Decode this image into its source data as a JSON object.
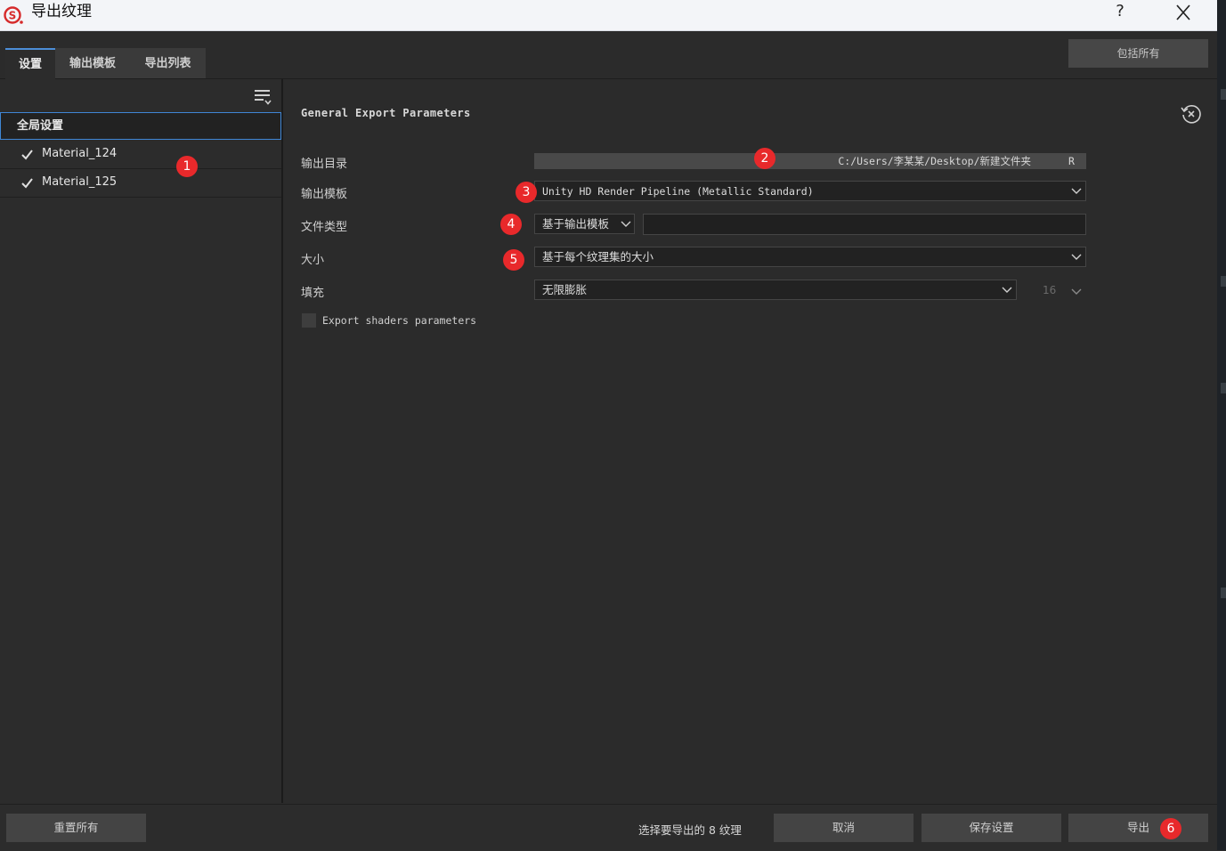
{
  "window": {
    "title": "导出纹理",
    "help_label": "?"
  },
  "tabs": [
    "设置",
    "输出模板",
    "导出列表"
  ],
  "include_all_label": "包括所有",
  "sidebar": {
    "global_label": "全局设置",
    "materials": [
      "Material_124",
      "Material_125"
    ]
  },
  "main": {
    "section_title": "General Export Parameters",
    "output_dir_label": "输出目录",
    "output_dir_value": "C:/Users/李某某/Desktop/新建文件夹",
    "output_dir_suffix": "R",
    "template_label": "输出模板",
    "template_value": "Unity HD Render Pipeline (Metallic Standard)",
    "file_type_label": "文件类型",
    "file_type_value": "基于输出模板",
    "size_label": "大小",
    "size_value": "基于每个纹理集的大小",
    "padding_label": "填充",
    "padding_value": "无限膨胀",
    "padding_amount": "16",
    "export_shaders_label": "Export shaders parameters"
  },
  "footer": {
    "reset_all_label": "重置所有",
    "status_text": "选择要导出的 8 纹理",
    "cancel_label": "取消",
    "save_settings_label": "保存设置",
    "export_label": "导出"
  },
  "annotations": [
    "1",
    "2",
    "3",
    "4",
    "5",
    "6"
  ],
  "colors": {
    "accent": "#4c8ed8",
    "badge": "#e8292b",
    "brand": "#d62b2b"
  }
}
